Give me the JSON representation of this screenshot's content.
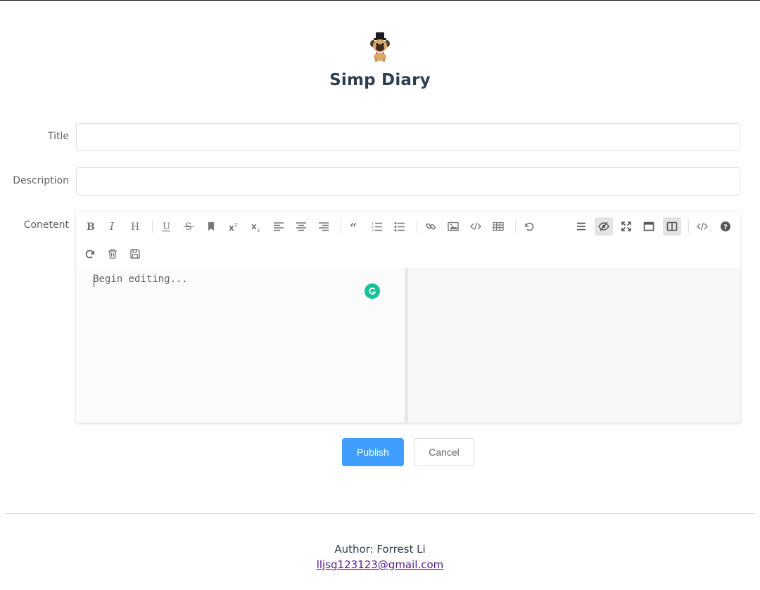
{
  "header": {
    "title": "Simp Diary",
    "logo_icon": "pug-with-top-hat-icon"
  },
  "form": {
    "title_label": "Title",
    "title_value": "",
    "description_label": "Description",
    "description_value": "",
    "content_label": "Conetent"
  },
  "editor": {
    "placeholder": "Begin editing...",
    "toolbar": [
      "bold",
      "italic",
      "header",
      "underline",
      "strikethrough",
      "mark",
      "superscript",
      "subscript",
      "align-left",
      "align-center",
      "align-right",
      "quote",
      "ordered-list",
      "unordered-list",
      "link",
      "image",
      "code",
      "table",
      "undo",
      "navigation",
      "preview",
      "fullscreen",
      "read-mode",
      "subfield",
      "html-code",
      "help",
      "redo",
      "trash",
      "save"
    ],
    "active_tools": [
      "preview",
      "subfield"
    ]
  },
  "actions": {
    "publish_label": "Publish",
    "cancel_label": "Cancel",
    "primary_color": "#409eff"
  },
  "footer": {
    "author": "Author: Forrest Li",
    "email": "lljsg123123@gmail.com"
  }
}
